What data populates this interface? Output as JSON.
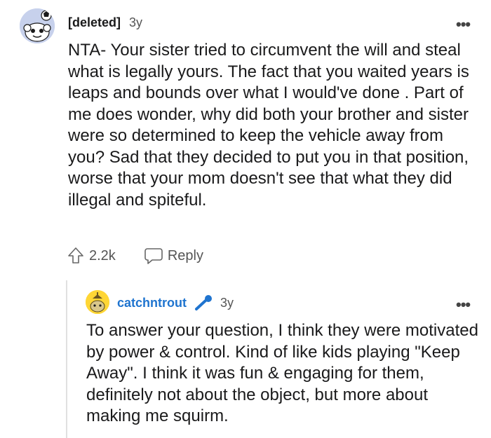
{
  "comment": {
    "author": "[deleted]",
    "age": "3y",
    "more_icon": "ellipsis-icon",
    "body": "NTA- Your sister tried to circumvent the will and steal what is legally yours. The fact that you waited years is leaps and bounds over what I would've done . Part of me does wonder, why did both your brother and sister were so determined to keep the vehicle away from you? Sad that they decided to put you in that position, worse that your mom doesn't see that what they did illegal and spiteful.",
    "upvotes": "2.2k",
    "reply_label": "Reply"
  },
  "reply": {
    "author": "catchntrout",
    "age": "3y",
    "flair_icon": "microphone-icon",
    "body": "To answer your question, I think they were motivated by power & control. Kind of like kids playing \"Keep Away\". I think it was fun & engaging for them, definitely not about the object, but more about making me squirm."
  },
  "colors": {
    "text": "#1a1a1b",
    "muted": "#555555",
    "reply_author": "#1f74cf",
    "avatar_bg": "#c7d1ec",
    "reply_avatar_bg": "#ffd635",
    "mic": "#1f74cf"
  }
}
